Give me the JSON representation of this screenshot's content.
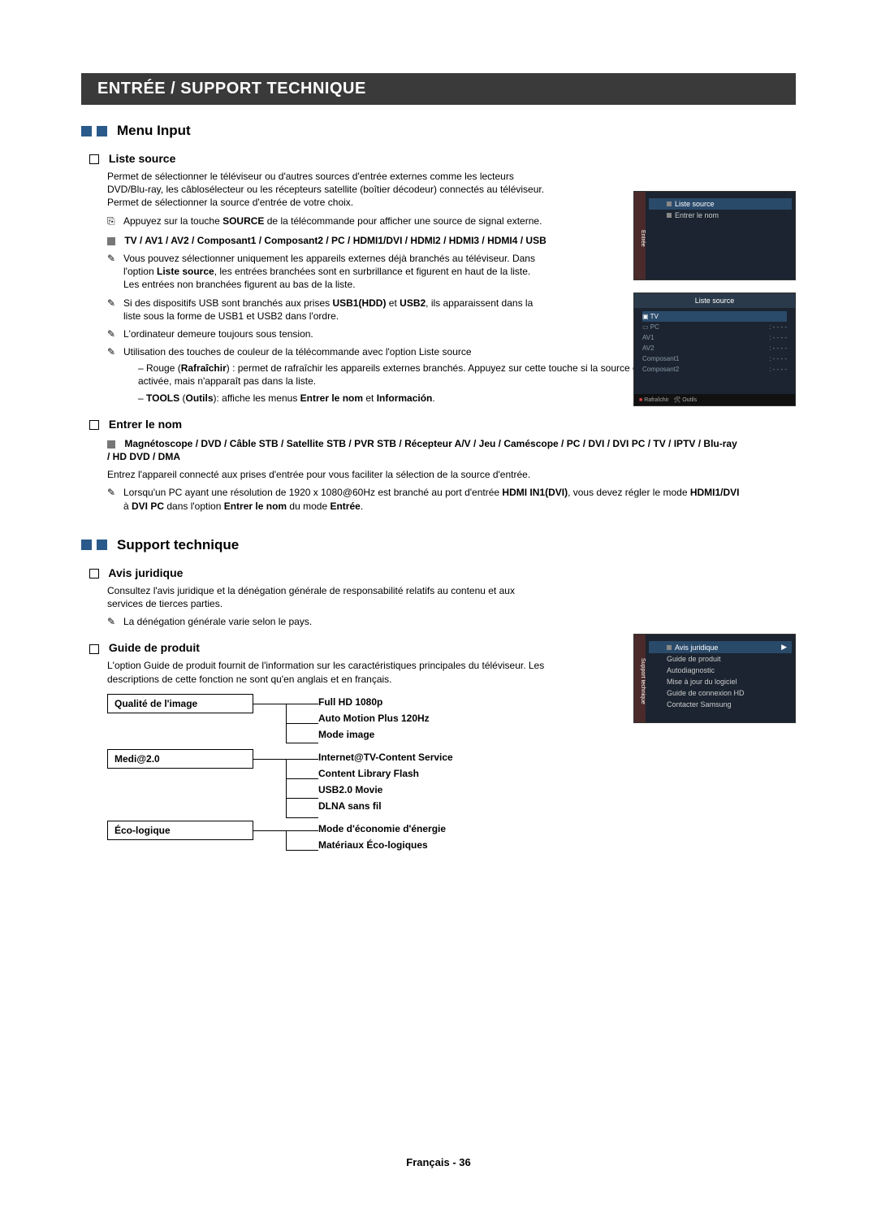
{
  "chapter": "ENTRÉE / SUPPORT TECHNIQUE",
  "sec1": {
    "title": "Menu Input",
    "liste_source": {
      "head": "Liste source",
      "p1": "Permet de sélectionner le téléviseur ou d'autres sources d'entrée externes comme les lecteurs DVD/Blu-ray, les câblosélecteur ou les récepteurs satellite (boîtier décodeur) connectés au téléviseur. Permet de sélectionner la source d'entrée de votre choix.",
      "n1_a": "Appuyez sur la touche ",
      "n1_b": "SOURCE",
      "n1_c": " de la télécommande pour afficher une source de signal externe.",
      "bullet": "TV / AV1 / AV2 / Composant1 / Composant2 / PC / HDMI1/DVI / HDMI2 / HDMI3 / HDMI4 / USB",
      "n2_a": "Vous pouvez sélectionner uniquement les appareils externes déjà branchés au téléviseur. Dans l'option ",
      "n2_b": "Liste source",
      "n2_c": ", les entrées branchées sont en surbrillance et figurent en haut de la liste. Les entrées non branchées figurent au bas de la liste.",
      "n3_a": "Si des dispositifs USB sont branchés aux prises ",
      "n3_b": "USB1(HDD)",
      "n3_c": " et ",
      "n3_d": "USB2",
      "n3_e": ", ils apparaissent dans la liste sous la forme de USB1 et USB2 dans l'ordre.",
      "n4": "L'ordinateur demeure toujours sous tension.",
      "n5": "Utilisation des touches de couleur de la télécommande avec l'option Liste source",
      "d1_a": "Rouge (",
      "d1_b": "Rafraîchir",
      "d1_c": ") : permet de rafraîchir les appareils externes branchés. Appuyez sur cette touche si la source est branchée et activée, mais n'apparaît pas dans la liste.",
      "d2_a": "TOOLS",
      "d2_b": " (",
      "d2_c": "Outils",
      "d2_d": "): affiche les menus ",
      "d2_e": "Entrer le nom",
      "d2_f": " et ",
      "d2_g": "Información",
      "d2_h": "."
    },
    "entrer": {
      "head": "Entrer le nom",
      "bullet": "Magnétoscope / DVD / Câble STB / Satellite STB / PVR STB / Récepteur A/V / Jeu / Caméscope / PC / DVI / DVI PC / TV / IPTV / Blu-ray / HD DVD / DMA",
      "p1": "Entrez l'appareil connecté aux prises d'entrée pour vous faciliter la sélection de la source d'entrée.",
      "n1_a": "Lorsqu'un PC ayant une résolution de 1920 x 1080@60Hz est branché au port d'entrée ",
      "n1_b": "HDMI IN1(DVI)",
      "n1_c": ", vous devez régler le mode ",
      "n1_d": "HDMI1/DVI",
      "n1_e": " à ",
      "n1_f": "DVI PC",
      "n1_g": " dans l'option ",
      "n1_h": "Entrer le nom",
      "n1_i": " du mode ",
      "n1_j": "Entrée",
      "n1_k": "."
    }
  },
  "sec2": {
    "title": "Support technique",
    "avis": {
      "head": "Avis juridique",
      "p1": "Consultez l'avis juridique et la dénégation générale de responsabilité relatifs au contenu et aux services de tierces parties.",
      "n1": "La dénégation générale varie selon le pays."
    },
    "guide": {
      "head": "Guide de produit",
      "p1": "L'option Guide de produit fournit de l'information sur les caractéristiques principales du téléviseur. Les descriptions de cette fonction ne sont qu'en anglais et en français."
    }
  },
  "tree": {
    "c1": {
      "label": "Qualité de l'image",
      "items": [
        "Full HD 1080p",
        "Auto Motion Plus 120Hz",
        "Mode image"
      ]
    },
    "c2": {
      "label": "Medi@2.0",
      "items": [
        "Internet@TV-Content Service",
        "Content Library Flash",
        "USB2.0 Movie",
        "DLNA sans fil"
      ]
    },
    "c3": {
      "label": "Éco-logique",
      "items": [
        "Mode d'économie d'énergie",
        "Matériaux Éco-logiques"
      ]
    }
  },
  "osd1": {
    "tab": "Entrée",
    "r1": "Liste source",
    "r2": "Entrer le nom"
  },
  "osd2": {
    "title": "Liste source",
    "rows": [
      "TV",
      "PC",
      "AV1",
      "AV2",
      "Composant1",
      "Composant2"
    ],
    "foot1": "Rafraîchir",
    "foot2": "Outils"
  },
  "osd3": {
    "tab": "Support technique",
    "r1": "Avis juridique",
    "rows": [
      "Guide de produit",
      "Autodiagnostic",
      "Mise à jour du logiciel",
      "Guide de connexion HD",
      "Contacter Samsung"
    ]
  },
  "footer_a": "Français - ",
  "footer_b": "36"
}
